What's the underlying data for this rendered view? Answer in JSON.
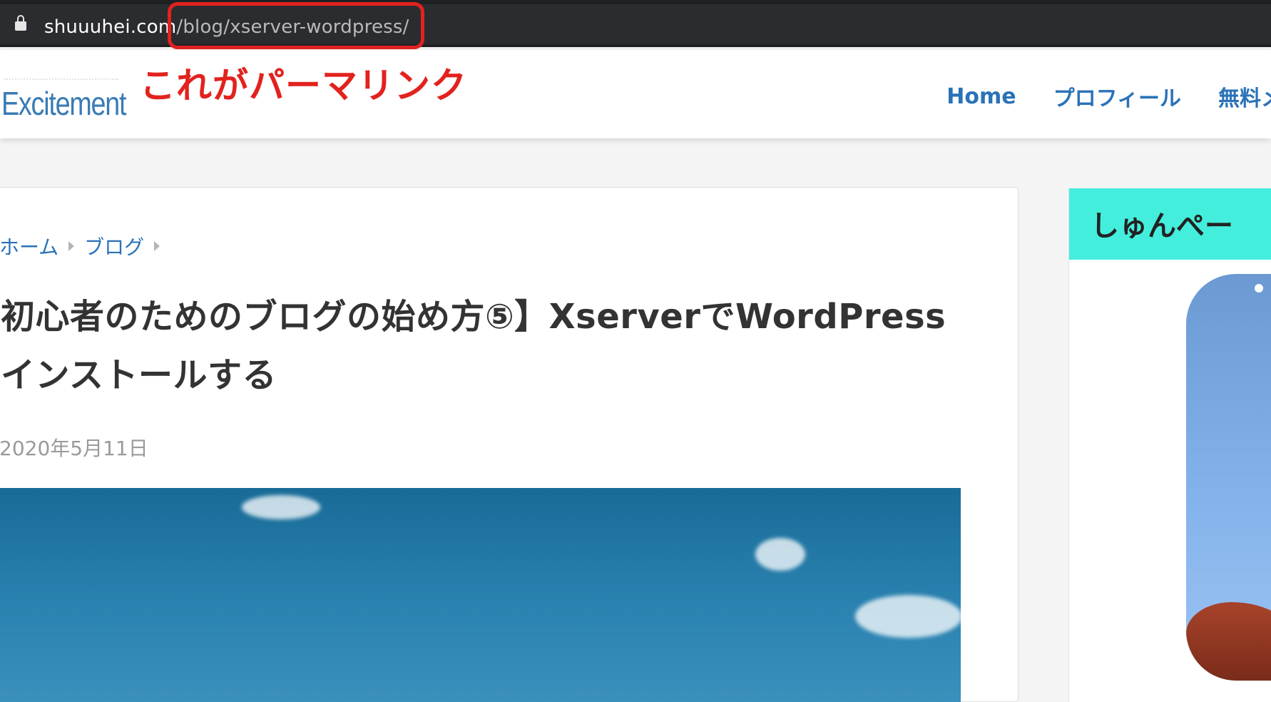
{
  "browser": {
    "url_domain": "shuuuhei.com",
    "url_path": "/blog/xserver-wordpress/",
    "lock_icon": "lock-icon",
    "highlight_color": "#e2221e"
  },
  "annotation": {
    "text": "これがパーマリンク",
    "color": "#e2221e"
  },
  "header": {
    "logo_text": "Excitement",
    "nav": [
      {
        "label": "Home"
      },
      {
        "label": "プロフィール"
      },
      {
        "label": "無料メルマ"
      }
    ],
    "nav_color": "#2a72b8"
  },
  "article": {
    "breadcrumb": [
      "ホーム",
      "ブログ"
    ],
    "title": "初心者のためのブログの始め方⑤】XserverでWordPress インストールする",
    "date": "2020年5月11日"
  },
  "sidebar": {
    "title": "しゅんぺー",
    "header_color": "#44eedd"
  }
}
